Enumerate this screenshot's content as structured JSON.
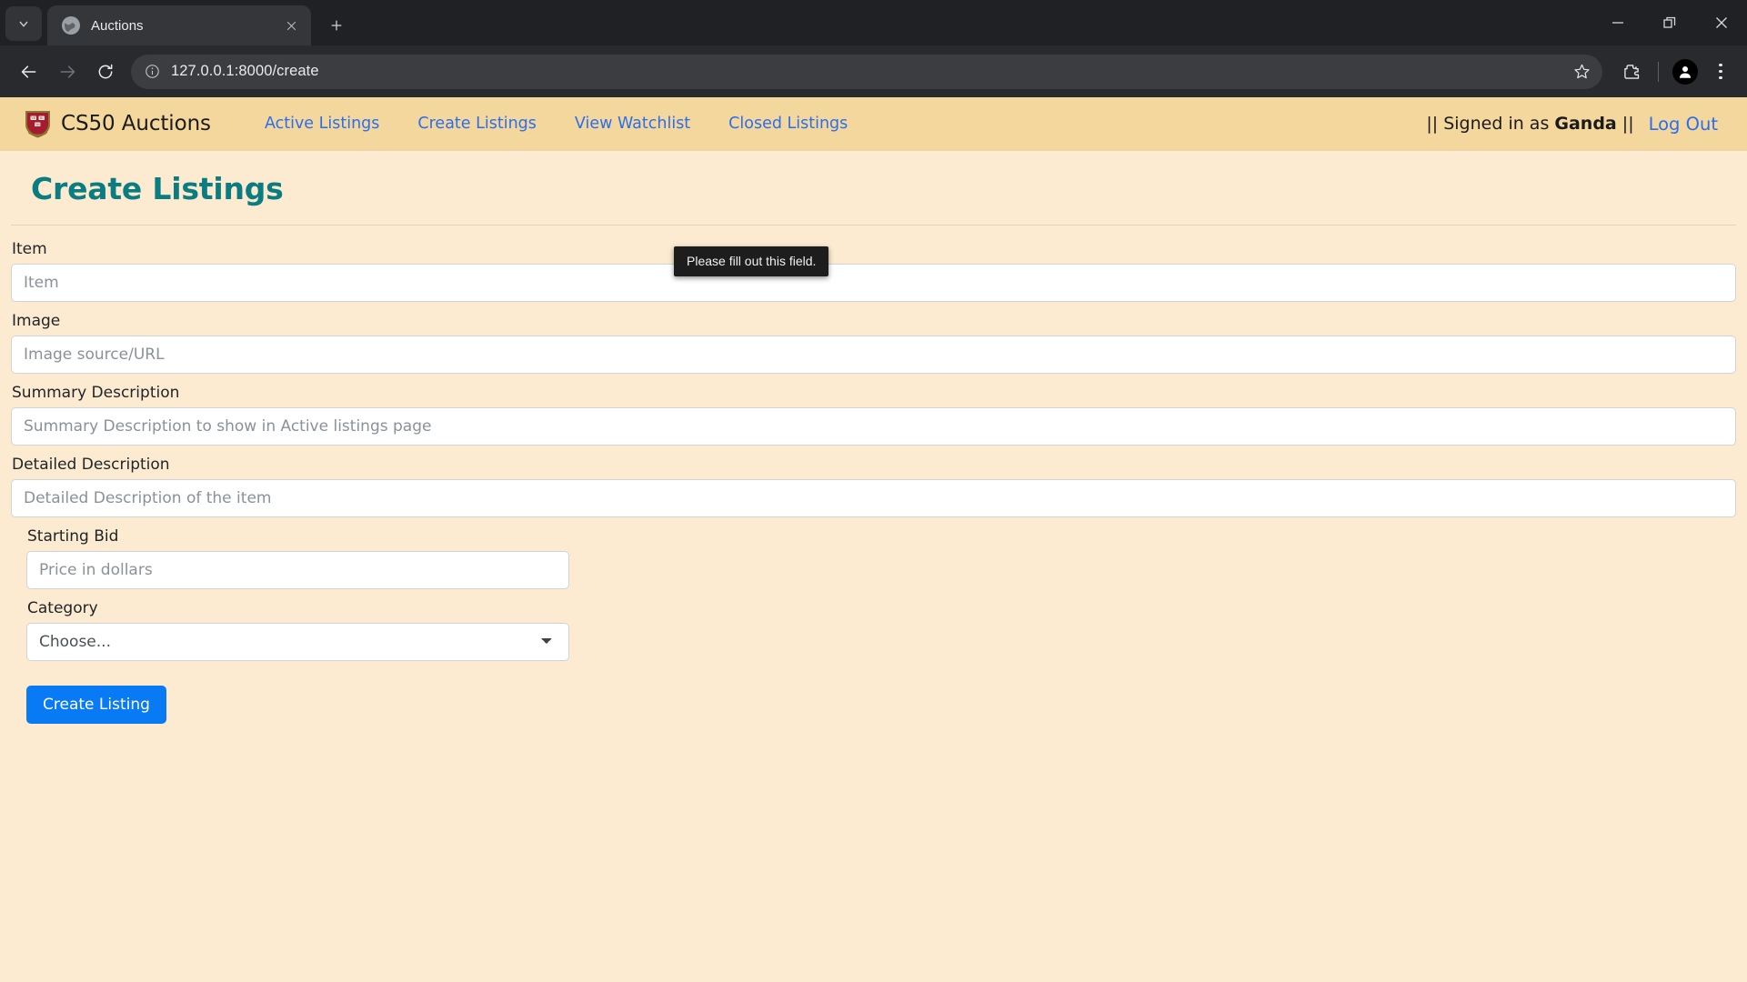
{
  "browser": {
    "tab": {
      "title": "Auctions",
      "favicon": "globe-icon"
    },
    "url": "127.0.0.1:8000/create",
    "controls": {
      "back": "back-arrow",
      "forward": "forward-arrow",
      "reload": "reload-icon",
      "info": "site-info-icon",
      "star": "bookmark-star-icon",
      "extensions": "extensions-puzzle-icon",
      "profile": "profile-avatar-icon",
      "menu": "three-dot-menu-icon",
      "minimize": "minimize-icon",
      "maximize": "restore-icon",
      "close": "close-icon",
      "tab_search": "tab-search-chevron-icon",
      "new_tab": "new-tab-plus-icon",
      "tab_close": "tab-close-icon"
    }
  },
  "site": {
    "brand": "CS50 Auctions",
    "logo": "harvard-crest-icon",
    "nav_links": [
      "Active Listings",
      "Create Listings",
      "View Watchlist",
      "Closed Listings"
    ],
    "auth": {
      "signed_in_prefix": "|| Signed in as ",
      "username": "Ganda",
      "signed_in_suffix": " ||",
      "logout": "Log Out"
    }
  },
  "page": {
    "title": "Create Listings",
    "fields": [
      {
        "label": "Item",
        "placeholder": "Item",
        "value": ""
      },
      {
        "label": "Image",
        "placeholder": "Image source/URL",
        "value": ""
      },
      {
        "label": "Summary Description",
        "placeholder": "Summary Description to show in Active listings page",
        "value": ""
      },
      {
        "label": "Detailed Description",
        "placeholder": "Detailed Description of the item",
        "value": ""
      },
      {
        "label": "Starting Bid",
        "placeholder": "Price in dollars",
        "value": ""
      }
    ],
    "category": {
      "label": "Category",
      "selected": "Choose...",
      "chevron": "chevron-down-icon"
    },
    "submit": "Create Listing",
    "validation_tooltip": "Please fill out this field."
  },
  "colors": {
    "body_bg": "#FCEBD0",
    "navbar_bg": "#F4D79D",
    "link": "#2a6ef0",
    "heading": "#0b7c80",
    "button": "#087af4",
    "crest": "#A51C30"
  }
}
